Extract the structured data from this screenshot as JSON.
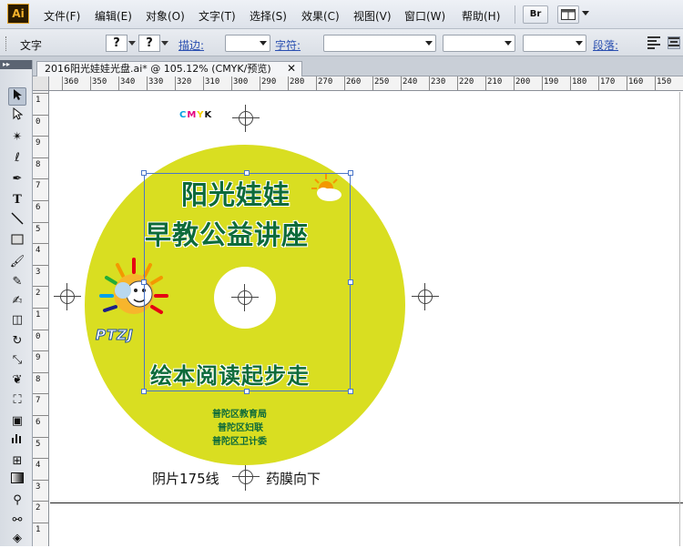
{
  "app": {
    "logo": "Ai",
    "menus": [
      "文件(F)",
      "编辑(E)",
      "对象(O)",
      "文字(T)",
      "选择(S)",
      "效果(C)",
      "视图(V)",
      "窗口(W)",
      "帮助(H)"
    ],
    "bridge_button": "Br"
  },
  "control_bar": {
    "tool_label": "文字",
    "question_mark_1": "?",
    "question_mark_2": "?",
    "stroke_label": "描边:",
    "character_label": "字符:",
    "paragraph_label": "段落:"
  },
  "tools_panel": {
    "header": "▸▸",
    "icons": [
      "selection-arrow-icon",
      "direct-selection-icon",
      "magic-wand-icon",
      "lasso-icon",
      "pen-icon",
      "type-icon",
      "line-segment-icon",
      "rectangle-icon",
      "paintbrush-icon",
      "pencil-icon",
      "blob-brush-icon",
      "eraser-icon",
      "rotate-icon",
      "scale-icon",
      "warp-icon",
      "free-transform-icon",
      "symbol-sprayer-icon",
      "column-graph-icon",
      "mesh-icon",
      "gradient-icon",
      "eyedropper-icon",
      "blend-icon",
      "live-paint-icon"
    ]
  },
  "document_tab": {
    "title": "2016阳光娃娃光盘.ai* @ 105.12% (CMYK/预览)",
    "close": "✕"
  },
  "ruler": {
    "top_labels": [
      "360",
      "350",
      "340",
      "330",
      "320",
      "310",
      "300",
      "290",
      "280",
      "270",
      "260",
      "250",
      "240",
      "230",
      "220",
      "210",
      "200",
      "190",
      "180",
      "170",
      "160",
      "150"
    ],
    "left_labels": [
      "1",
      "0",
      "9",
      "8",
      "7",
      "6",
      "5",
      "4",
      "3",
      "2",
      "1",
      "0",
      "9",
      "8",
      "7",
      "6",
      "5",
      "4",
      "3",
      "2",
      "1"
    ]
  },
  "artwork": {
    "cmyk": {
      "c": "C",
      "m": "M",
      "y": "Y",
      "k": "K"
    },
    "title_line1": "阳光娃娃",
    "title_line2": "早教公益讲座",
    "subtitle": "绘本阅读起步走",
    "logo_text": "PTZJ",
    "org_line1": "普陀区教育局",
    "org_line2": "普陀区妇联",
    "org_line3": "普陀区卫计委",
    "bottom_left": "阴片175线",
    "bottom_right": "药膜向下",
    "disc_color": "#d9de21",
    "text_color": "#0e6b3a",
    "selection_color": "#4a76c9"
  }
}
